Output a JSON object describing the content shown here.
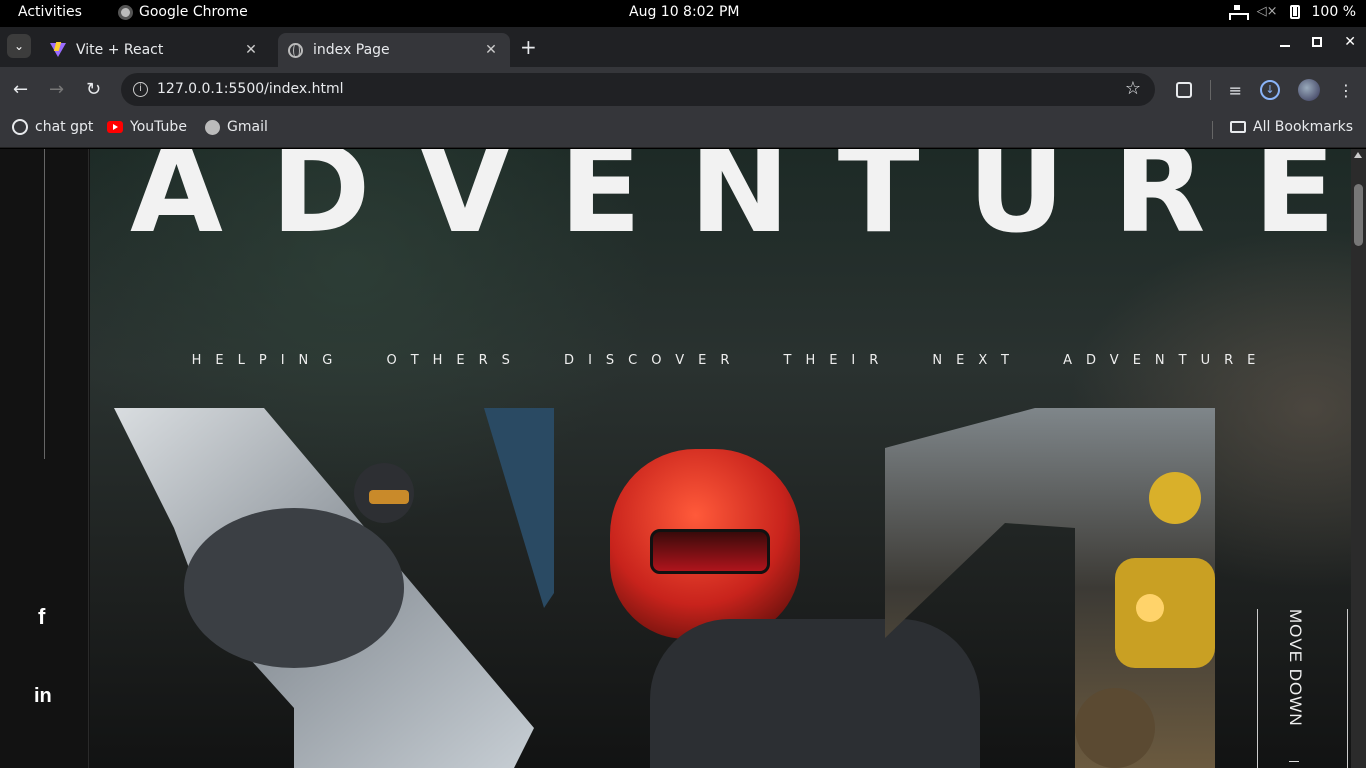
{
  "os": {
    "activities": "Activities",
    "app_name": "Google Chrome",
    "clock": "Aug 10  8:02 PM",
    "battery": "100 %"
  },
  "browser": {
    "tabs": [
      {
        "title": "Vite + React",
        "icon": "vite-icon"
      },
      {
        "title": "index Page",
        "icon": "globe-icon",
        "active": true
      }
    ],
    "url": "127.0.0.1:5500/index.html",
    "bookmarks": [
      {
        "label": "chat gpt",
        "icon": "chatgpt-icon"
      },
      {
        "label": "YouTube",
        "icon": "youtube-icon"
      },
      {
        "label": "Gmail",
        "icon": "globe-icon"
      }
    ],
    "all_bookmarks": "All Bookmarks"
  },
  "page": {
    "hero_title": "ADVENTURE",
    "hero_subtitle": "HELPING OTHERS DISCOVER THEIR NEXT ADVENTURE",
    "social": {
      "facebook": "f",
      "linkedin": "in"
    },
    "move_down": "MOVE DOWN"
  },
  "colors": {
    "chrome_dark": "#202124",
    "chrome_toolbar": "#35363a",
    "page_bg": "#121212",
    "helmet_red": "#c8231c"
  }
}
